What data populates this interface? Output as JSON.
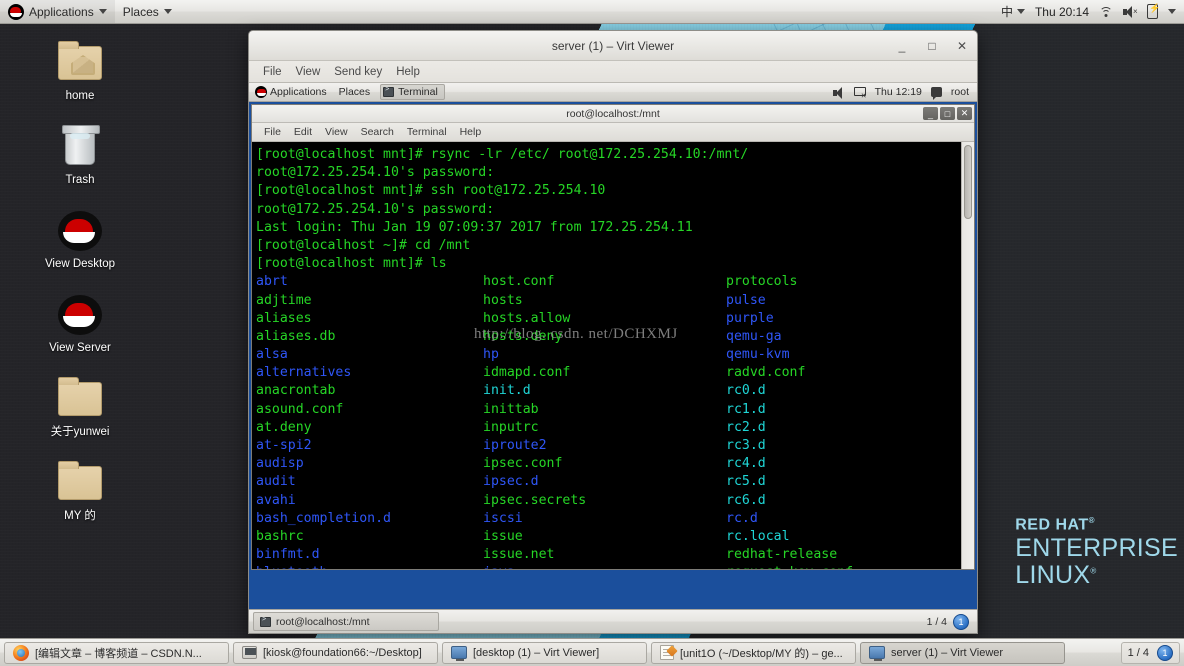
{
  "top_panel": {
    "logo_icon": "redhat-logo-icon",
    "applications_label": "Applications",
    "places_label": "Places",
    "input_method": "中",
    "clock": "Thu 20:14",
    "wifi_icon": "wifi-icon",
    "volume_icon": "volume-muted-icon",
    "battery_icon": "battery-icon"
  },
  "desktop_icons": [
    {
      "label": "home",
      "icon": "home-folder-icon"
    },
    {
      "label": "Trash",
      "icon": "trash-icon"
    },
    {
      "label": "View Desktop",
      "icon": "redhat-hat-icon"
    },
    {
      "label": "View Server",
      "icon": "redhat-hat-icon"
    },
    {
      "label": "关于yunwei",
      "icon": "folder-icon"
    },
    {
      "label": "MY 的",
      "icon": "folder-icon"
    }
  ],
  "wallpaper": {
    "brand_line1": "RED HAT",
    "brand_line2": "ENTERPRISE",
    "brand_line3": "LINUX",
    "trademark": "®",
    "colors": {
      "dark": "#242428",
      "light_blue": "#86cfe4",
      "blue": "#13a3dc"
    }
  },
  "virt_viewer": {
    "title": "server (1) – Virt Viewer",
    "window_buttons": {
      "minimize": "_",
      "maximize": "□",
      "close": "✕"
    },
    "menu": [
      "File",
      "View",
      "Send key",
      "Help"
    ]
  },
  "guest_panel": {
    "applications_label": "Applications",
    "places_label": "Places",
    "task_label": "Terminal",
    "volume_icon": "volume-icon",
    "network_icon": "network-disconnected-icon",
    "clock": "Thu 12:19",
    "user": "root"
  },
  "terminal": {
    "title": "root@localhost:/mnt",
    "window_buttons": {
      "minimize": "_",
      "maximize": "□",
      "close": "✕"
    },
    "menu": [
      "File",
      "Edit",
      "View",
      "Search",
      "Terminal",
      "Help"
    ],
    "session_lines": [
      "[root@localhost mnt]# rsync -lr /etc/ root@172.25.254.10:/mnt/",
      "root@172.25.254.10's password:",
      "[root@localhost mnt]# ssh root@172.25.254.10",
      "root@172.25.254.10's password:",
      "Last login: Thu Jan 19 07:09:37 2017 from 172.25.254.11",
      "[root@localhost ~]# cd /mnt",
      "[root@localhost mnt]# ls"
    ],
    "listing_rows": [
      [
        {
          "n": "abrt",
          "c": "blue"
        },
        {
          "n": "host.conf",
          "c": "green"
        },
        {
          "n": "protocols",
          "c": "green"
        }
      ],
      [
        {
          "n": "adjtime",
          "c": "green"
        },
        {
          "n": "hosts",
          "c": "green"
        },
        {
          "n": "pulse",
          "c": "blue"
        }
      ],
      [
        {
          "n": "aliases",
          "c": "green"
        },
        {
          "n": "hosts.allow",
          "c": "green"
        },
        {
          "n": "purple",
          "c": "blue"
        }
      ],
      [
        {
          "n": "aliases.db",
          "c": "green"
        },
        {
          "n": "hosts.deny",
          "c": "green"
        },
        {
          "n": "qemu-ga",
          "c": "blue"
        }
      ],
      [
        {
          "n": "alsa",
          "c": "blue"
        },
        {
          "n": "hp",
          "c": "blue"
        },
        {
          "n": "qemu-kvm",
          "c": "blue"
        }
      ],
      [
        {
          "n": "alternatives",
          "c": "blue"
        },
        {
          "n": "idmapd.conf",
          "c": "green"
        },
        {
          "n": "radvd.conf",
          "c": "green"
        }
      ],
      [
        {
          "n": "anacrontab",
          "c": "green"
        },
        {
          "n": "init.d",
          "c": "cyan"
        },
        {
          "n": "rc0.d",
          "c": "cyan"
        }
      ],
      [
        {
          "n": "asound.conf",
          "c": "green"
        },
        {
          "n": "inittab",
          "c": "green"
        },
        {
          "n": "rc1.d",
          "c": "cyan"
        }
      ],
      [
        {
          "n": "at.deny",
          "c": "green"
        },
        {
          "n": "inputrc",
          "c": "green"
        },
        {
          "n": "rc2.d",
          "c": "cyan"
        }
      ],
      [
        {
          "n": "at-spi2",
          "c": "blue"
        },
        {
          "n": "iproute2",
          "c": "blue"
        },
        {
          "n": "rc3.d",
          "c": "cyan"
        }
      ],
      [
        {
          "n": "audisp",
          "c": "blue"
        },
        {
          "n": "ipsec.conf",
          "c": "green"
        },
        {
          "n": "rc4.d",
          "c": "cyan"
        }
      ],
      [
        {
          "n": "audit",
          "c": "blue"
        },
        {
          "n": "ipsec.d",
          "c": "blue"
        },
        {
          "n": "rc5.d",
          "c": "cyan"
        }
      ],
      [
        {
          "n": "avahi",
          "c": "blue"
        },
        {
          "n": "ipsec.secrets",
          "c": "green"
        },
        {
          "n": "rc6.d",
          "c": "cyan"
        }
      ],
      [
        {
          "n": "bash_completion.d",
          "c": "blue"
        },
        {
          "n": "iscsi",
          "c": "blue"
        },
        {
          "n": "rc.d",
          "c": "blue"
        }
      ],
      [
        {
          "n": "bashrc",
          "c": "green"
        },
        {
          "n": "issue",
          "c": "green"
        },
        {
          "n": "rc.local",
          "c": "cyan"
        }
      ],
      [
        {
          "n": "binfmt.d",
          "c": "blue"
        },
        {
          "n": "issue.net",
          "c": "green"
        },
        {
          "n": "redhat-release",
          "c": "green"
        }
      ],
      [
        {
          "n": "bluetooth",
          "c": "blue"
        },
        {
          "n": "java",
          "c": "blue"
        },
        {
          "n": "request-key.conf",
          "c": "green"
        }
      ]
    ]
  },
  "watermark": {
    "text": "http://blog. csdn. net/DCHXMJ"
  },
  "guest_taskbar": {
    "task_label": "root@localhost:/mnt",
    "task_icon": "terminal-icon",
    "workspace_indicator": "1 / 4",
    "workspace_badge": "1"
  },
  "bottom_panel": {
    "tasks": [
      {
        "label": "[编辑文章 – 博客频道 – CSDN.N...",
        "icon": "firefox-icon",
        "active": false
      },
      {
        "label": "[kiosk@foundation66:~/Desktop]",
        "icon": "terminal-icon",
        "active": false
      },
      {
        "label": "[desktop (1) – Virt Viewer]",
        "icon": "monitor-icon",
        "active": false
      },
      {
        "label": "[unit1O (~/Desktop/MY 的) – ge...",
        "icon": "gedit-icon",
        "active": false
      },
      {
        "label": "server (1) – Virt Viewer",
        "icon": "monitor-icon",
        "active": true
      }
    ],
    "workspace_indicator": "1 / 4",
    "workspace_badge": "1"
  }
}
